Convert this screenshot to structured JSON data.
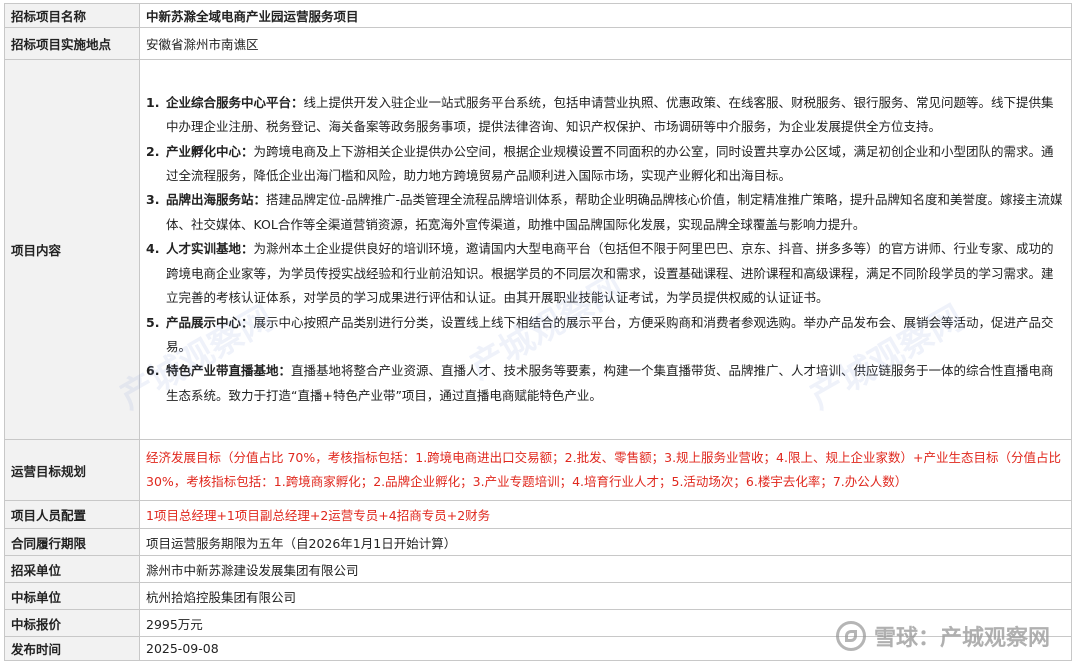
{
  "rows": {
    "project_name": {
      "label": "招标项目名称",
      "value": "中新苏滁全域电商产业园运营服务项目"
    },
    "location": {
      "label": "招标项目实施地点",
      "value": "安徽省滁州市南谯区"
    },
    "content": {
      "label": "项目内容",
      "items": [
        {
          "num": "1.",
          "title": "企业综合服务中心平台：",
          "text": "线上提供开发入驻企业一站式服务平台系统，包括申请营业执照、优惠政策、在线客服、财税服务、银行服务、常见问题等。线下提供集中办理企业注册、税务登记、海关备案等政务服务事项，提供法律咨询、知识产权保护、市场调研等中介服务，为企业发展提供全方位支持。"
        },
        {
          "num": "2.",
          "title": "产业孵化中心：",
          "text": "为跨境电商及上下游相关企业提供办公空间，根据企业规模设置不同面积的办公室，同时设置共享办公区域，满足初创企业和小型团队的需求。通过全流程服务，降低企业出海门槛和风险，助力地方跨境贸易产品顺利进入国际市场，实现产业孵化和出海目标。"
        },
        {
          "num": "3.",
          "title": "品牌出海服务站：",
          "text": "搭建品牌定位-品牌推广-品类管理全流程品牌培训体系，帮助企业明确品牌核心价值，制定精准推广策略，提升品牌知名度和美誉度。嫁接主流媒体、社交媒体、KOL合作等全渠道营销资源，拓宽海外宣传渠道，助推中国品牌国际化发展，实现品牌全球覆盖与影响力提升。"
        },
        {
          "num": "4.",
          "title": "人才实训基地：",
          "text": "为滁州本土企业提供良好的培训环境，邀请国内大型电商平台（包括但不限于阿里巴巴、京东、抖音、拼多多等）的官方讲师、行业专家、成功的跨境电商企业家等，为学员传授实战经验和行业前沿知识。根据学员的不同层次和需求，设置基础课程、进阶课程和高级课程，满足不同阶段学员的学习需求。建立完善的考核认证体系，对学员的学习成果进行评估和认证。由其开展职业技能认证考试，为学员提供权威的认证证书。"
        },
        {
          "num": "5.",
          "title": "产品展示中心：",
          "text": "展示中心按照产品类别进行分类，设置线上线下相结合的展示平台，方便采购商和消费者参观选购。举办产品发布会、展销会等活动，促进产品交易。"
        },
        {
          "num": "6.",
          "title": "特色产业带直播基地：",
          "text": "直播基地将整合产业资源、直播人才、技术服务等要素，构建一个集直播带货、品牌推广、人才培训、供应链服务于一体的综合性直播电商生态系统。致力于打造“直播+特色产业带”项目，通过直播电商赋能特色产业。"
        }
      ]
    },
    "goals": {
      "label": "运营目标规划",
      "value": "经济发展目标（分值占比 70%，考核指标包括：1.跨境电商进出口交易额；2.批发、零售额；3.规上服务业营收；4.限上、规上企业家数）+产业生态目标（分值占比 30%，考核指标包括：1.跨境商家孵化；2.品牌企业孵化；3.产业专题培训；4.培育行业人才；5.活动场次；6.楼宇去化率；7.办公人数）"
    },
    "staff": {
      "label": "项目人员配置",
      "value": "1项目总经理+1项目副总经理+2运营专员+4招商专员+2财务"
    },
    "term": {
      "label": "合同履行期限",
      "value": "项目运营服务期限为五年（自2026年1月1日开始计算）"
    },
    "buyer": {
      "label": "招采单位",
      "value": "滁州市中新苏滁建设发展集团有限公司"
    },
    "winner": {
      "label": "中标单位",
      "value": "杭州拾焰控股集团有限公司"
    },
    "price": {
      "label": "中标报价",
      "value": "2995万元"
    },
    "date": {
      "label": "发布时间",
      "value": "2025-09-08"
    }
  },
  "watermark": {
    "text": "产城观察网",
    "footer": "雪球：产城观察网"
  },
  "colors": {
    "label_bg": "#f2f2f2",
    "border": "#c8c8c8",
    "highlight": "#e0281e"
  }
}
